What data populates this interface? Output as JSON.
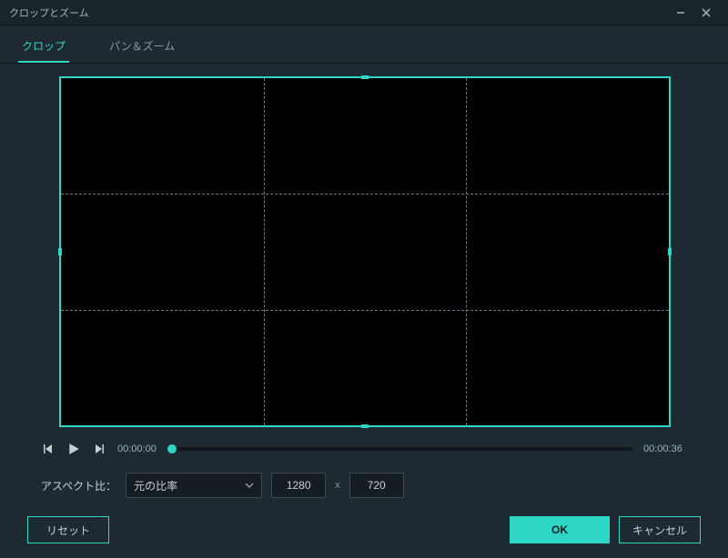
{
  "window": {
    "title": "クロップとズーム"
  },
  "tabs": {
    "crop": "クロップ",
    "panzoom": "パン＆ズーム"
  },
  "playback": {
    "current": "00:00:00",
    "duration": "00:00:36"
  },
  "aspect": {
    "label": "アスペクト比：",
    "selected": "元の比率",
    "width": "1280",
    "sep": "x",
    "height": "720"
  },
  "buttons": {
    "reset": "リセット",
    "ok": "OK",
    "cancel": "キャンセル"
  }
}
